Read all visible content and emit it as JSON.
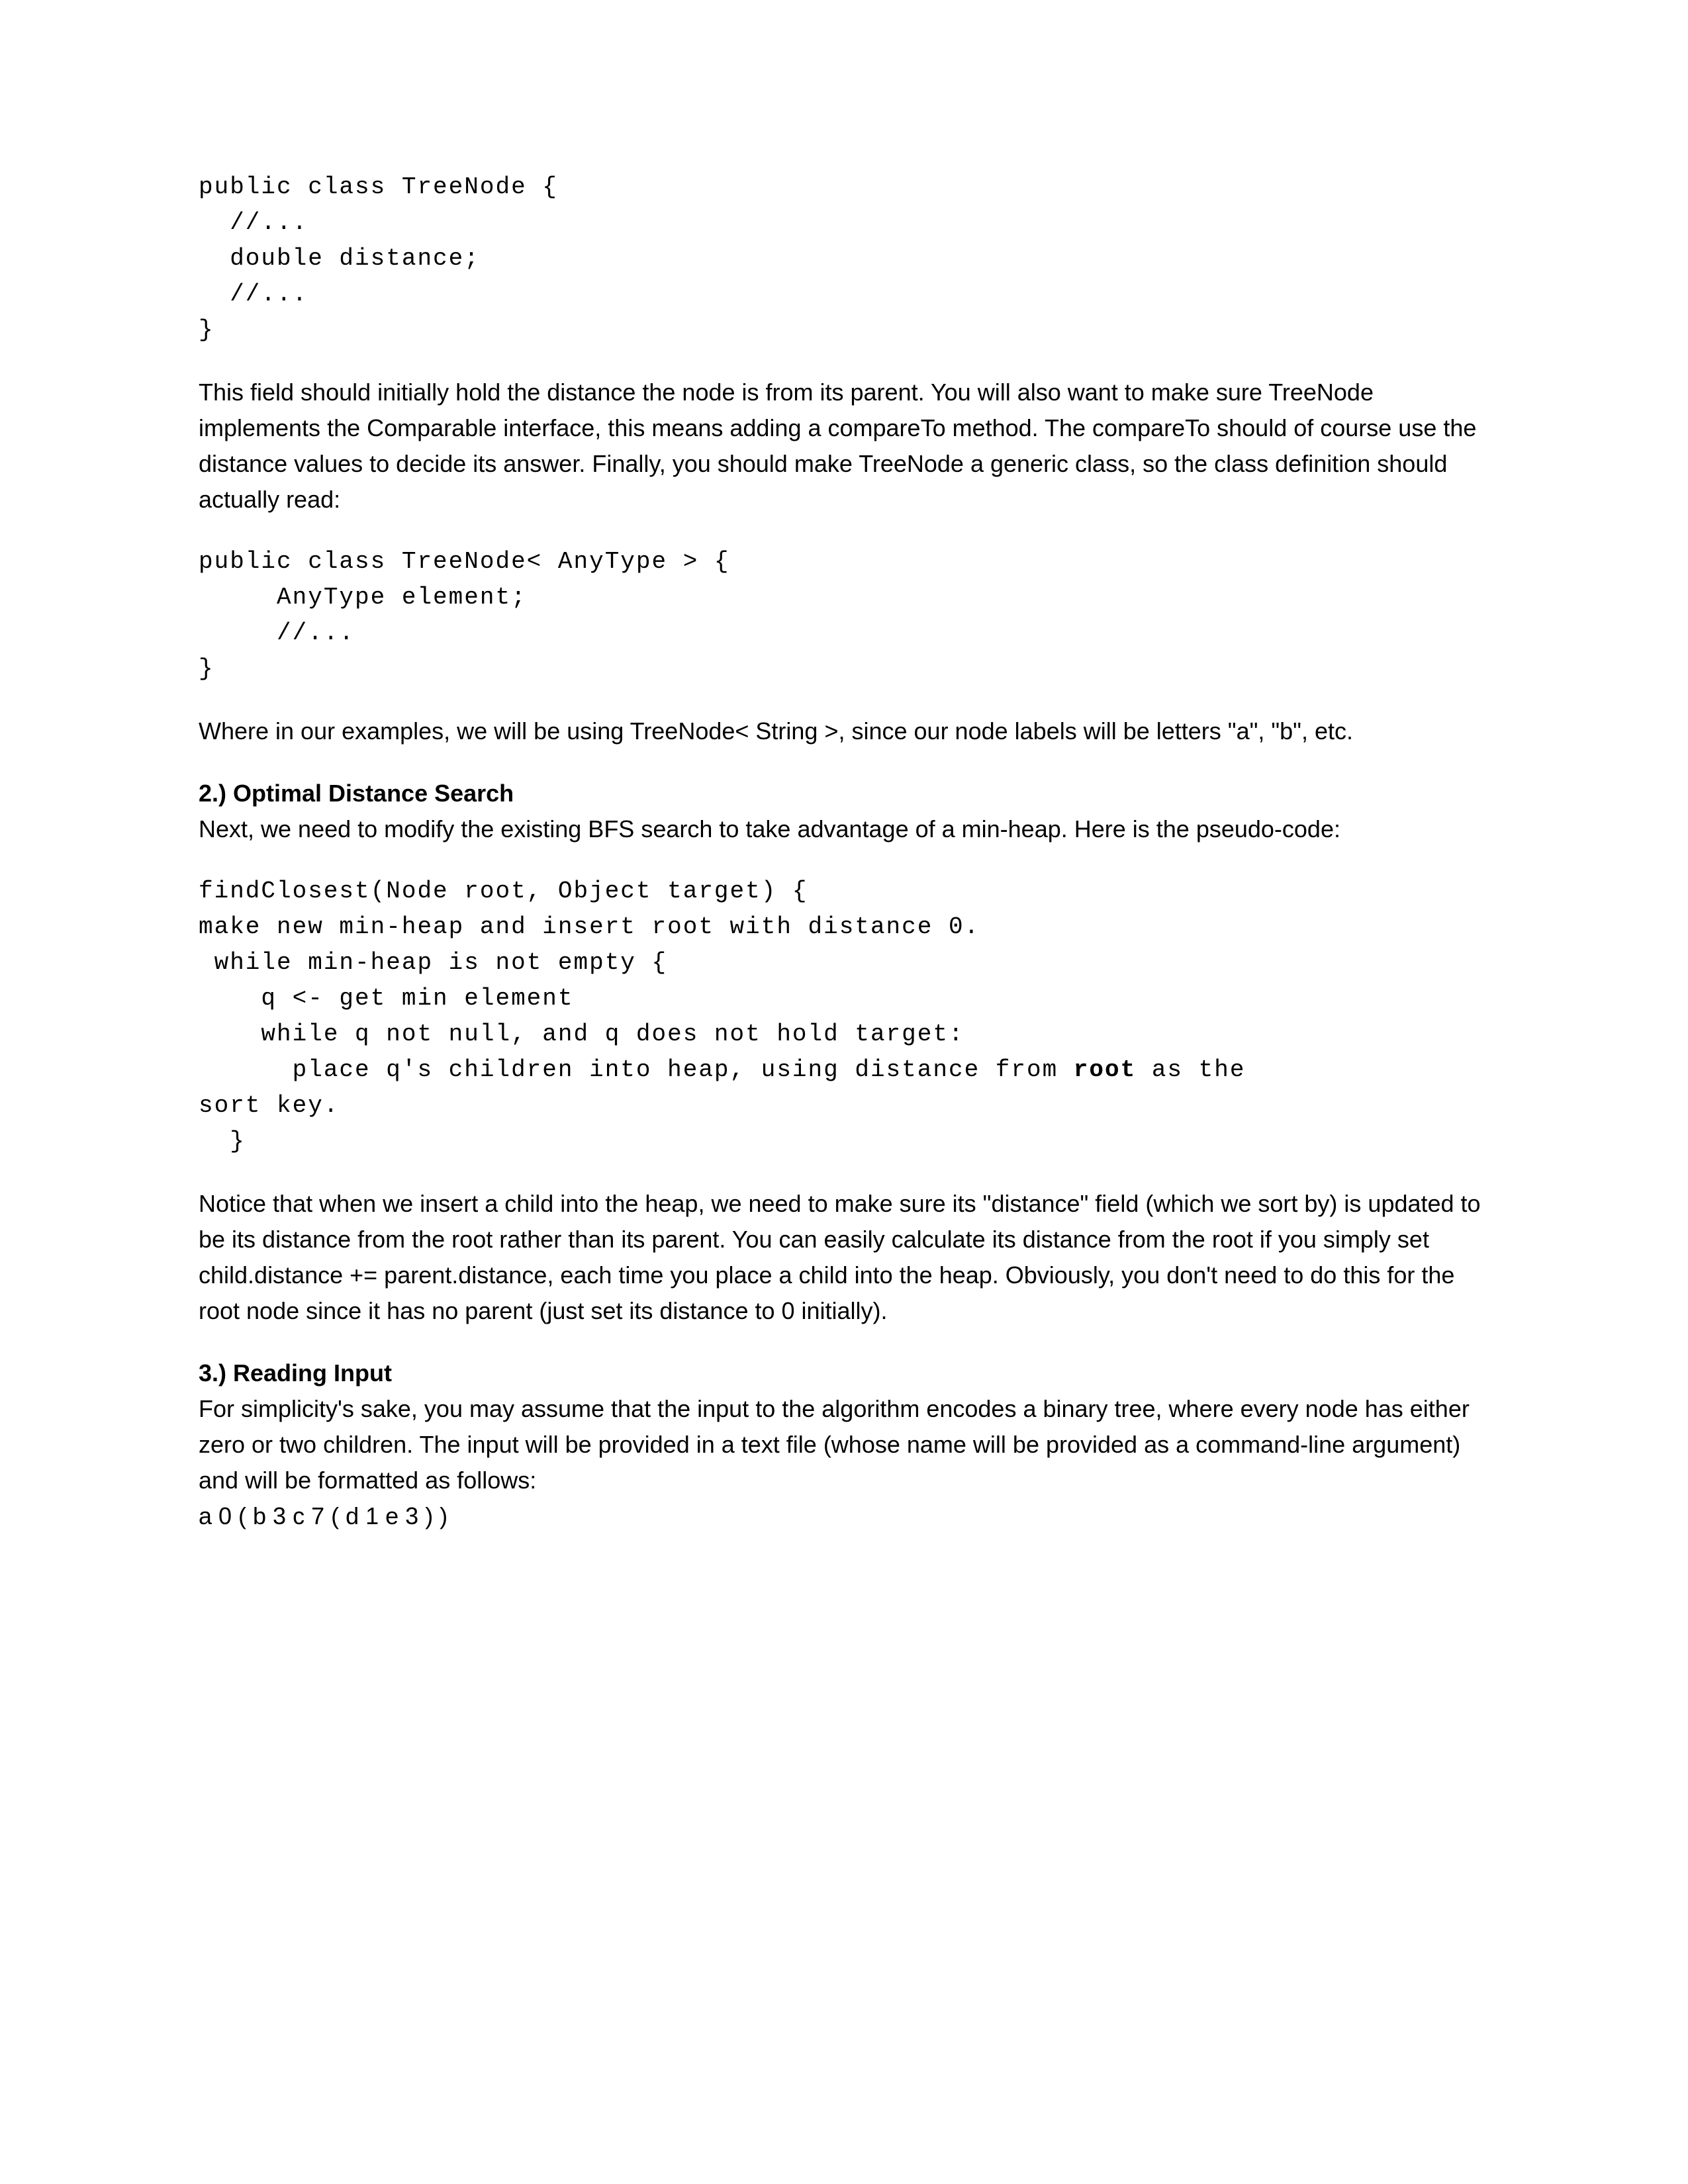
{
  "code1": "public class TreeNode {\n  //...\n  double distance;\n  //...\n}",
  "para1": "This field should initially hold the distance the node is from its parent. You will also want to make sure TreeNode implements the Comparable interface, this means adding a compareTo method. The compareTo should of course use the distance values to decide its answer. Finally, you should make TreeNode a generic class, so the class definition should actually read:",
  "code2": "public class TreeNode< AnyType > {\n     AnyType element;\n     //...\n}",
  "para2": "Where in our examples, we will be using TreeNode< String >, since our node labels will be letters \"a\", \"b\", etc.",
  "h2": "2.) Optimal Distance Search",
  "para3": "Next, we need to modify the existing BFS search to take advantage of a min-heap. Here is the pseudo-code:",
  "code3a": "findClosest(Node root, Object target) {\nmake new min-heap and insert root with distance 0.\n while min-heap is not empty {\n    q <- get min element\n    while q not null, and q does not hold target:\n      place q's children into heap, using distance from ",
  "code3bold": "root",
  "code3b": " as the\nsort key.\n  }",
  "para4": "Notice that when we insert a child into the heap, we need to make sure its \"distance\" field (which we sort by) is updated to be its distance from the root rather than its parent. You can easily calculate its distance from the root if you simply set child.distance += parent.distance, each time you place a child into the heap. Obviously, you don't need to do this for the root node since it has no parent (just set its distance to 0 initially).",
  "h3": "3.) Reading Input",
  "para5": "For simplicity's sake, you may assume that the input to the algorithm encodes a binary tree, where every node has either zero or two children. The input will be provided in a text file (whose name will be provided as a command-line argument) and will be formatted as follows:",
  "para6": "a 0 ( b 3 c 7 ( d 1 e 3 ) )"
}
